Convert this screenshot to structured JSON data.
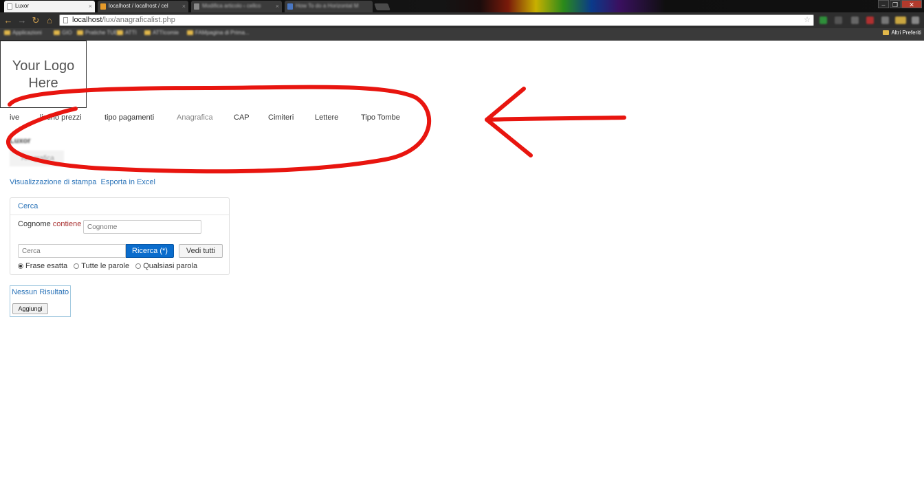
{
  "browser": {
    "tabs": [
      {
        "title": "Luxor",
        "active": true
      },
      {
        "title": "localhost / localhost / cel",
        "active": false
      },
      {
        "title": "Modifica articolo ‹ cellco",
        "active": false
      },
      {
        "title": "How To do a Horizontal M",
        "active": false
      }
    ],
    "close_glyph": "×",
    "window_controls": {
      "minimize": "–",
      "restore": "❐",
      "close": "✕"
    },
    "address": {
      "host": "localhost",
      "path": "/lux/anagraficalist.php"
    },
    "bookmarks": [
      "Applicazioni",
      "GIO",
      "Pratiche TUEV",
      "ATTI",
      "SITO",
      "ATTIcomie",
      "FAMpagina  di Prima..."
    ],
    "other_bookmarks": "Altri Preferiti"
  },
  "logo": {
    "line1": "Your Logo",
    "line2": "Here"
  },
  "menu": {
    "items": [
      {
        "label": "ive",
        "active": false
      },
      {
        "label": "listino prezzi",
        "active": false
      },
      {
        "label": "tipo pagamenti",
        "active": false
      },
      {
        "label": "Anagrafica",
        "active": true
      },
      {
        "label": "CAP",
        "active": false
      },
      {
        "label": "Cimiteri",
        "active": false
      },
      {
        "label": "Lettere",
        "active": false
      },
      {
        "label": "Tipo Tombe",
        "active": false
      }
    ]
  },
  "brand": "Luxor",
  "breadcrumb": "Anagrafica",
  "links": {
    "print": "Visualizzazione di stampa",
    "excel": "Esporta in Excel"
  },
  "search": {
    "title": "Cerca",
    "field_label": "Cognome",
    "operator": "contiene",
    "cognome_placeholder": "Cognome",
    "search_placeholder": "Cerca",
    "search_button": "Ricerca (*)",
    "show_all_button": "Vedi tutti",
    "options": [
      {
        "label": "Frase esatta",
        "selected": true
      },
      {
        "label": "Tutte le parole",
        "selected": false
      },
      {
        "label": "Qualsiasi parola",
        "selected": false
      }
    ]
  },
  "results": {
    "message": "Nessun Risultato",
    "add_button": "Aggiungi"
  },
  "annotation_color": "#e8150f"
}
